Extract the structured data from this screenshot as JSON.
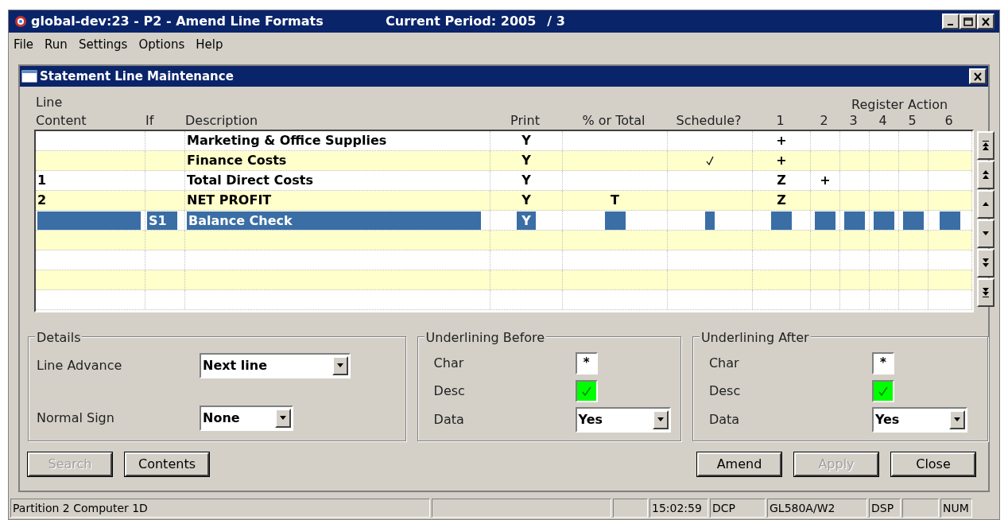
{
  "app_window": {
    "title": "global-dev:23 - P2 - Amend Line Formats",
    "period_label": "Current Period: 2005",
    "period_suffix": "/ 3"
  },
  "menu": [
    "File",
    "Run",
    "Settings",
    "Options",
    "Help"
  ],
  "dialog": {
    "title": "Statement Line Maintenance"
  },
  "table": {
    "column_group": "Register Action",
    "columns": [
      {
        "top": "Line",
        "label": "Content"
      },
      {
        "label": "If"
      },
      {
        "label": "Description"
      },
      {
        "label": "Print"
      },
      {
        "label": "% or Total"
      },
      {
        "label": "Schedule?"
      },
      {
        "label": "1"
      },
      {
        "label": "2"
      },
      {
        "label": "3"
      },
      {
        "label": "4"
      },
      {
        "label": "5"
      },
      {
        "label": "6"
      }
    ],
    "rows": [
      {
        "description": "Marketing & Office Supplies",
        "print": "Y",
        "schedule": false,
        "register": [
          "+"
        ],
        "selected": false
      },
      {
        "description": "Finance Costs",
        "print": "Y",
        "schedule": true,
        "register": [
          "+"
        ],
        "selected": false
      },
      {
        "content": "1",
        "description": "Total Direct Costs",
        "print": "Y",
        "schedule": false,
        "register": [
          "Z",
          "+"
        ],
        "selected": false
      },
      {
        "content": "2",
        "description": "NET PROFIT",
        "print": "Y",
        "total": "T",
        "schedule": false,
        "register": [
          "Z"
        ],
        "selected": false
      },
      {
        "if": "S1",
        "description": "Balance Check",
        "print": "Y",
        "schedule": false,
        "register": [],
        "selected": true
      }
    ]
  },
  "details": {
    "title": "Details",
    "fields": [
      {
        "label": "Line Advance",
        "value": "Next line"
      },
      {
        "label": "Normal Sign",
        "value": "None"
      }
    ]
  },
  "underlining": [
    {
      "title": "Underlining Before",
      "char_label": "Char",
      "char": "*",
      "desc_label": "Desc",
      "desc_checked": true,
      "data_label": "Data",
      "data": "Yes"
    },
    {
      "title": "Underlining After",
      "char_label": "Char",
      "char": "*",
      "desc_label": "Desc",
      "desc_checked": true,
      "data_label": "Data",
      "data": "Yes"
    }
  ],
  "left_buttons": [
    {
      "label": "Search",
      "disabled": true
    },
    {
      "label": "Contents",
      "disabled": false
    }
  ],
  "right_buttons": [
    {
      "label": "Amend",
      "disabled": false
    },
    {
      "label": "Apply",
      "disabled": true
    },
    {
      "label": "Close",
      "disabled": false
    }
  ],
  "status_bar": [
    {
      "kind": "text",
      "text": "Partition 2 Computer 1D"
    },
    {
      "kind": "blank"
    },
    {
      "kind": "blank"
    },
    {
      "kind": "text",
      "text": "15:02:59"
    },
    {
      "kind": "text",
      "text": "DCP"
    },
    {
      "kind": "text",
      "text": "GL580A/W2"
    },
    {
      "kind": "text",
      "text": "DSP"
    },
    {
      "kind": "blank"
    },
    {
      "kind": "text",
      "text": "NUM"
    }
  ]
}
